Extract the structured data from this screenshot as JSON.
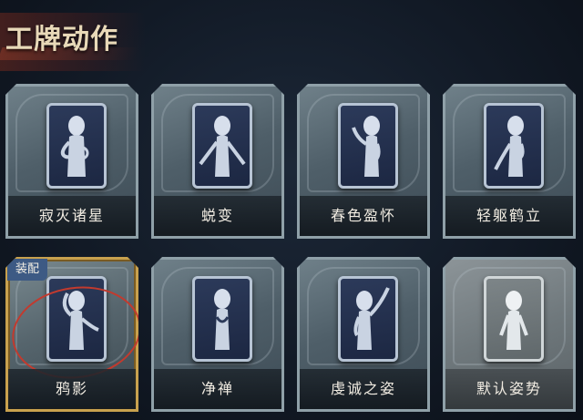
{
  "header": {
    "title": "工牌动作"
  },
  "cards": [
    {
      "label": "寂灭诸星",
      "pose": "ponder"
    },
    {
      "label": "蜕变",
      "pose": "spread"
    },
    {
      "label": "春色盈怀",
      "pose": "hand-up"
    },
    {
      "label": "轻躯鹤立",
      "pose": "bow"
    },
    {
      "label": "鸦影",
      "pose": "salute",
      "equipped": true,
      "badge": "装配"
    },
    {
      "label": "净禅",
      "pose": "pray"
    },
    {
      "label": "虔诚之姿",
      "pose": "raise-arm"
    },
    {
      "label": "默认姿势",
      "pose": "default"
    }
  ],
  "colors": {
    "equipped_border": "#c8a14e",
    "equipped_ring": "#c23a2e",
    "badge": "#3d5a84"
  }
}
